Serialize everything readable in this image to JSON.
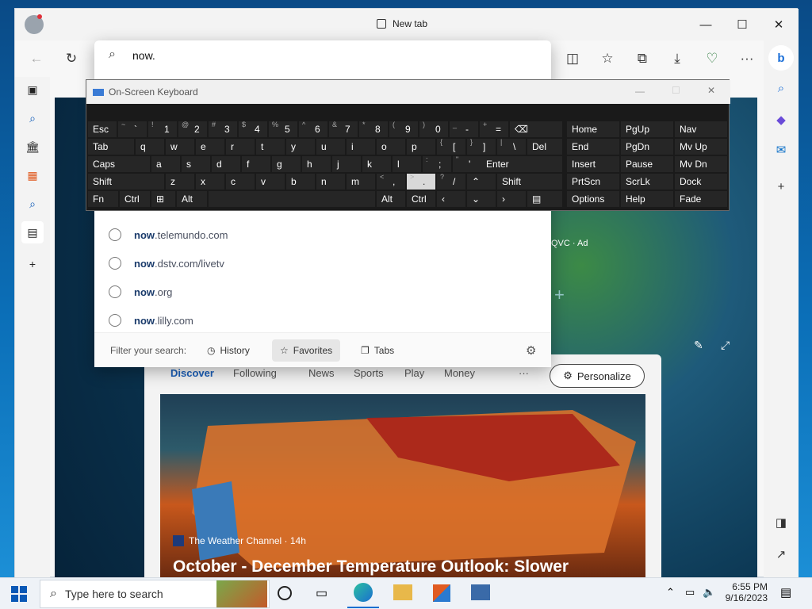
{
  "browser": {
    "tab_title": "New tab",
    "address_value": "now.",
    "suggestions": [
      {
        "bold": "now",
        "rest": ".telemundo.com"
      },
      {
        "bold": "now",
        "rest": ".dstv.com/livetv"
      },
      {
        "bold": "now",
        "rest": ".org"
      },
      {
        "bold": "now",
        "rest": ".lilly.com"
      }
    ],
    "filter_label": "Filter your search:",
    "filter_history": "History",
    "filter_favorites": "Favorites",
    "filter_tabs": "Tabs"
  },
  "ntp": {
    "ad_label": "QVC · Ad",
    "feed_tabs": [
      "Discover",
      "Following",
      "News",
      "Sports",
      "Play",
      "Money"
    ],
    "more": "···",
    "personalize": "Personalize",
    "card_source": "The Weather Channel · 14h",
    "card_headline": "October - December Temperature Outlook: Slower"
  },
  "osk": {
    "title": "On-Screen Keyboard",
    "row1": [
      {
        "sub": "~",
        "main": "`"
      },
      {
        "sub": "!",
        "main": "1"
      },
      {
        "sub": "@",
        "main": "2"
      },
      {
        "sub": "#",
        "main": "3"
      },
      {
        "sub": "$",
        "main": "4"
      },
      {
        "sub": "%",
        "main": "5"
      },
      {
        "sub": "^",
        "main": "6"
      },
      {
        "sub": "&",
        "main": "7"
      },
      {
        "sub": "*",
        "main": "8"
      },
      {
        "sub": "(",
        "main": "9"
      },
      {
        "sub": ")",
        "main": "0"
      },
      {
        "sub": "_",
        "main": "-"
      },
      {
        "sub": "+",
        "main": "="
      }
    ],
    "esc": "Esc",
    "row2": [
      "q",
      "w",
      "e",
      "r",
      "t",
      "y",
      "u",
      "i",
      "o",
      "p"
    ],
    "tab": "Tab",
    "del": "Del",
    "row3": [
      "a",
      "s",
      "d",
      "f",
      "g",
      "h",
      "j",
      "k",
      "l"
    ],
    "caps": "Caps",
    "enter": "Enter",
    "row4": [
      "z",
      "x",
      "c",
      "v",
      "b",
      "n",
      "m"
    ],
    "shift": "Shift",
    "fn": "Fn",
    "ctrl": "Ctrl",
    "alt": "Alt",
    "nav_keys": [
      [
        "Home",
        "PgUp",
        "Nav"
      ],
      [
        "End",
        "PgDn",
        "Mv Up"
      ],
      [
        "Insert",
        "Pause",
        "Mv Dn"
      ],
      [
        "PrtScn",
        "ScrLk",
        "Dock"
      ],
      [
        "Options",
        "Help",
        "Fade"
      ]
    ]
  },
  "taskbar": {
    "search_placeholder": "Type here to search",
    "time": "6:55 PM",
    "date": "9/16/2023"
  }
}
